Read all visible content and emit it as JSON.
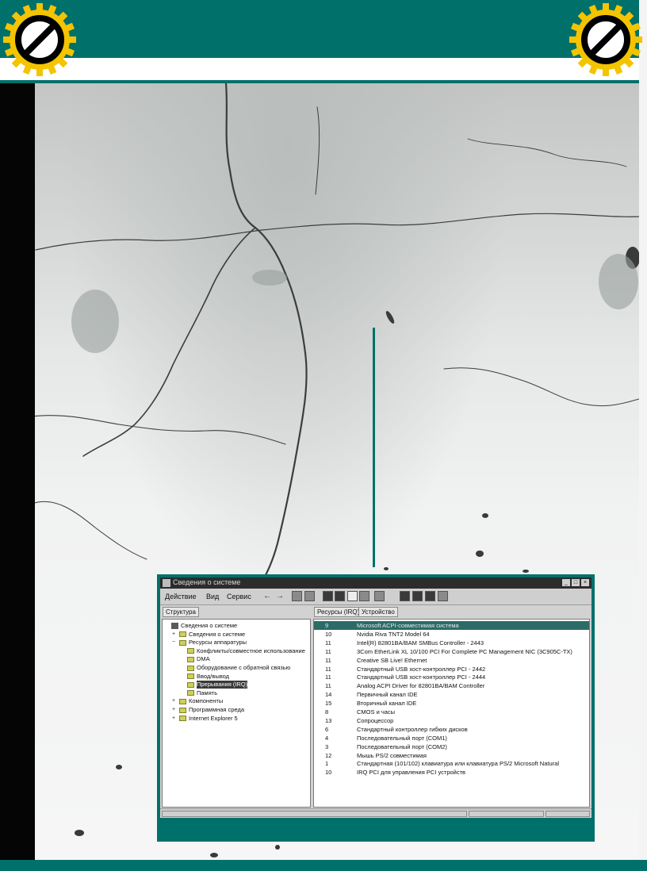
{
  "window": {
    "title": "Сведения о системе",
    "menu": [
      "Действие",
      "Вид",
      "Сервис"
    ],
    "tabs": [
      "Структура",
      "Ресурсы (IRQ)",
      "Устройство"
    ],
    "tree": [
      {
        "label": "Сведения о системе",
        "type": "pc",
        "indent": 0,
        "prefix": ""
      },
      {
        "label": "Сведения о системе",
        "type": "folder",
        "indent": 1,
        "prefix": "+"
      },
      {
        "label": "Ресурсы аппаратуры",
        "type": "folder",
        "indent": 1,
        "prefix": "−"
      },
      {
        "label": "Конфликты/совместное использование",
        "type": "folder",
        "indent": 2,
        "prefix": ""
      },
      {
        "label": "DMA",
        "type": "folder",
        "indent": 2,
        "prefix": ""
      },
      {
        "label": "Оборудование с обратной связью",
        "type": "folder",
        "indent": 2,
        "prefix": ""
      },
      {
        "label": "Ввод/вывод",
        "type": "folder",
        "indent": 2,
        "prefix": ""
      },
      {
        "label": "Прерывания (IRQ)",
        "type": "folder",
        "indent": 2,
        "prefix": "",
        "selected": true
      },
      {
        "label": "Память",
        "type": "folder",
        "indent": 2,
        "prefix": ""
      },
      {
        "label": "Компоненты",
        "type": "folder",
        "indent": 1,
        "prefix": "+"
      },
      {
        "label": "Программная среда",
        "type": "folder",
        "indent": 1,
        "prefix": "+"
      },
      {
        "label": "Internet Explorer 5",
        "type": "folder",
        "indent": 1,
        "prefix": "+"
      }
    ],
    "list": [
      {
        "irq": "9",
        "device": "Microsoft ACPI-совместимая система",
        "selected": true
      },
      {
        "irq": "10",
        "device": "Nvidia Riva TNT2 Model 64"
      },
      {
        "irq": "11",
        "device": "Intel(R) 82801BA/BAM SMBus Controller - 2443"
      },
      {
        "irq": "11",
        "device": "3Com EtherLink XL 10/100 PCI For Complete PC Management NIC (3C905C-TX)"
      },
      {
        "irq": "11",
        "device": "Creative SB Live! Ethernet"
      },
      {
        "irq": "11",
        "device": "Стандартный USB хост-контроллер PCI - 2442"
      },
      {
        "irq": "11",
        "device": "Стандартный USB хост-контроллер PCI - 2444"
      },
      {
        "irq": "11",
        "device": "Analog ACPI Driver for 82801BA/BAM Controller"
      },
      {
        "irq": "14",
        "device": "Первичный канал IDE"
      },
      {
        "irq": "15",
        "device": "Вторичный канал IDE"
      },
      {
        "irq": "8",
        "device": "CMOS и часы"
      },
      {
        "irq": "13",
        "device": "Сопроцессор"
      },
      {
        "irq": "6",
        "device": "Стандартный контроллер гибких дисков"
      },
      {
        "irq": "4",
        "device": "Последовательный порт (COM1)"
      },
      {
        "irq": "3",
        "device": "Последовательный порт (COM2)"
      },
      {
        "irq": "12",
        "device": "Мышь PS/2 совместимая"
      },
      {
        "irq": "1",
        "device": "Стандартная (101/102) клавиатура или клавиатура PS/2 Microsoft Natural"
      },
      {
        "irq": "10",
        "device": "IRQ PCI для управления PCI устройств"
      }
    ]
  },
  "colors": {
    "accent": "#00706b",
    "badge_gear": "#f4c400",
    "badge_ring": "#000000"
  },
  "icons": {
    "badge": "prohibition-icon"
  }
}
